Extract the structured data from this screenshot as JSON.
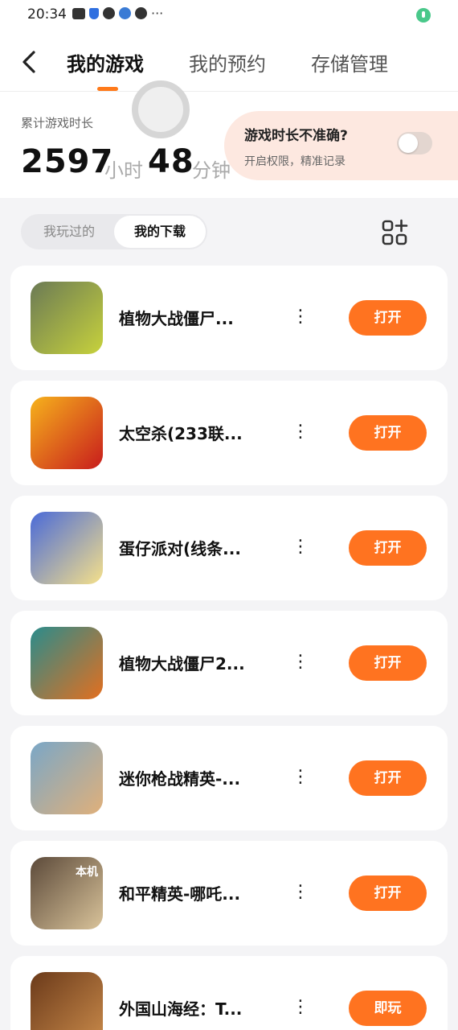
{
  "status_bar": {
    "time": "20:34",
    "more": "···"
  },
  "header": {
    "tabs": [
      {
        "label": "我的游戏",
        "active": true
      },
      {
        "label": "我的预约",
        "active": false
      },
      {
        "label": "存储管理",
        "active": false
      }
    ]
  },
  "stats": {
    "label": "累计游戏时长",
    "hours": "2597",
    "hours_unit": "小时",
    "minutes": "48",
    "minutes_unit": "分钟"
  },
  "banner": {
    "title": "游戏时长不准确?",
    "subtitle": "开启权限，精准记录",
    "toggle_on": false
  },
  "segment": {
    "played": "我玩过的",
    "downloads": "我的下载",
    "active": "downloads"
  },
  "games": [
    {
      "name": "植物大战僵尸...",
      "action": "打开",
      "icon": "pvz-icon",
      "colors": [
        "#6b7a55",
        "#c7d23c"
      ]
    },
    {
      "name": "太空杀(233联...",
      "action": "打开",
      "icon": "space-kill-icon",
      "colors": [
        "#f6b21c",
        "#c81c1c"
      ]
    },
    {
      "name": "蛋仔派对(线条...",
      "action": "打开",
      "icon": "eggy-party-icon",
      "colors": [
        "#4a6ad8",
        "#f5e08a"
      ]
    },
    {
      "name": "植物大战僵尸2...",
      "action": "打开",
      "icon": "pvz2-icon",
      "colors": [
        "#2a8c8c",
        "#e36f1f"
      ]
    },
    {
      "name": "迷你枪战精英-...",
      "action": "打开",
      "icon": "mini-gun-icon",
      "colors": [
        "#7aa7c7",
        "#e0b07a"
      ]
    },
    {
      "name": "和平精英-哪吒...",
      "action": "打开",
      "icon": "peace-elite-icon",
      "badge": "本机",
      "colors": [
        "#5c4a3a",
        "#d9c39a"
      ]
    },
    {
      "name": "外国山海经：T...",
      "action": "即玩",
      "icon": "foreign-myth-icon",
      "colors": [
        "#6b3a1a",
        "#c98a4a"
      ]
    }
  ]
}
